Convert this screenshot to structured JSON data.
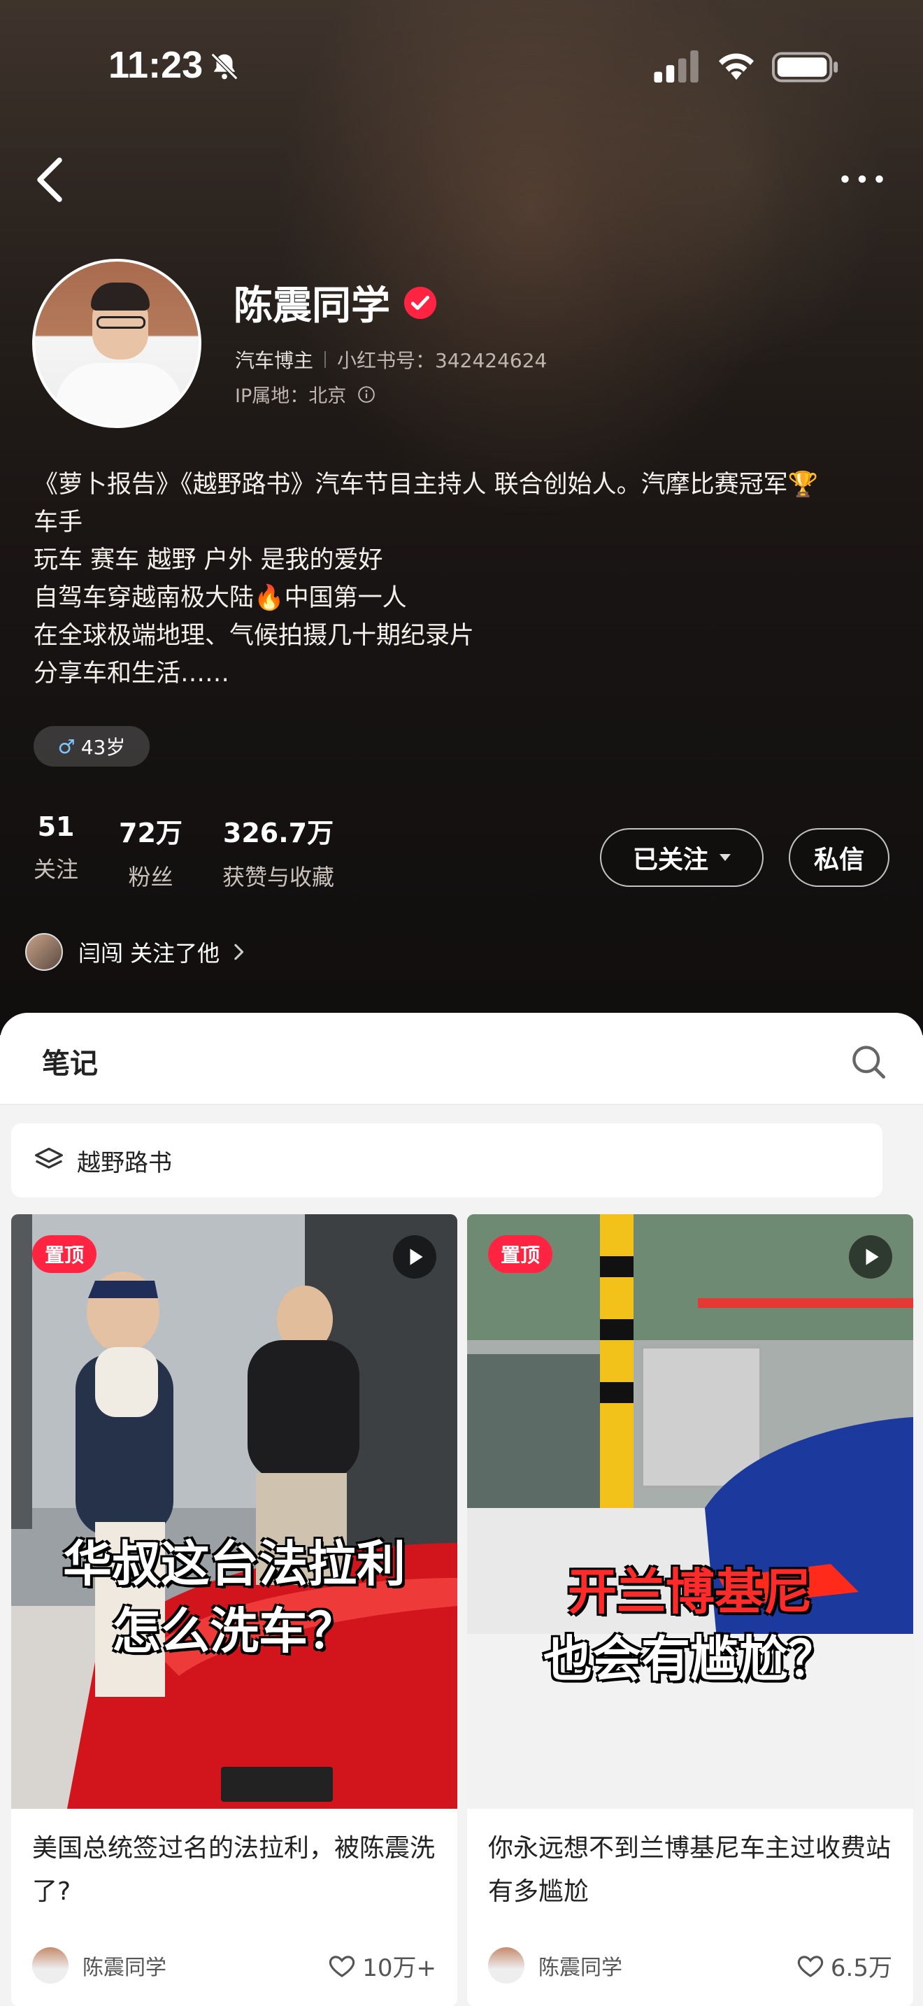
{
  "status_bar": {
    "time": "11:23"
  },
  "profile": {
    "name": "陈震同学",
    "role": "汽车博主",
    "redbook_id": "小红书号：342424624",
    "ip_location": "IP属地：北京",
    "bio": [
      "《萝卜报告》《越野路书》汽车节目主持人 联合创始人。汽摩比赛冠军🏆",
      "车手",
      "玩车 赛车 越野 户外 是我的爱好",
      "自驾车穿越南极大陆🔥中国第一人",
      "在全球极端地理、气候拍摄几十期纪录片",
      "分享车和生活……"
    ],
    "age": "43岁",
    "stats": [
      {
        "value": "51",
        "label": "关注"
      },
      {
        "value": "72万",
        "label": "粉丝"
      },
      {
        "value": "326.7万",
        "label": "获赞与收藏"
      }
    ],
    "follow_label": "已关注",
    "message_label": "私信",
    "mutual_text": "闫闯 关注了他"
  },
  "tabs": {
    "notes_label": "笔记"
  },
  "collection": {
    "label": "越野路书"
  },
  "cards": [
    {
      "pin_label": "置顶",
      "caption_line1": "华叔这台法拉利",
      "caption_line2": "怎么洗车？",
      "title": "美国总统签过名的法拉利，被陈震洗了?",
      "author": "陈震同学",
      "likes": "10万+"
    },
    {
      "pin_label": "置顶",
      "caption_line1": "开兰博基尼",
      "caption_line2": "也会有尴尬？",
      "title": "你永远想不到兰博基尼车主过收费站有多尴尬",
      "author": "陈震同学",
      "likes": "6.5万"
    }
  ],
  "colors": {
    "accent": "#ff2442",
    "header_bg": "#2a2320"
  }
}
